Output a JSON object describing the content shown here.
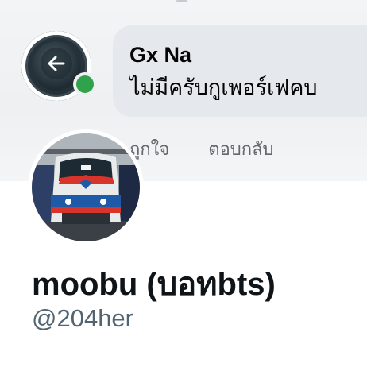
{
  "banner_comment": {
    "commenter_name": "Gx Na",
    "comment_text": "ไม่มีครับกูเพอร์เฟคบ",
    "actions": [
      "ถูกใจ",
      "ตอบกลับ"
    ]
  },
  "profile": {
    "display_name": "moobu (บอทbts)",
    "handle": "@204her"
  },
  "colors": {
    "online_dot": "#31a24c",
    "bubble": "#e5e8ec",
    "handle": "#536471",
    "name": "#0f1419"
  },
  "icons": {
    "back": "back-arrow-icon",
    "avatar_photo": "bts-train-photo"
  }
}
